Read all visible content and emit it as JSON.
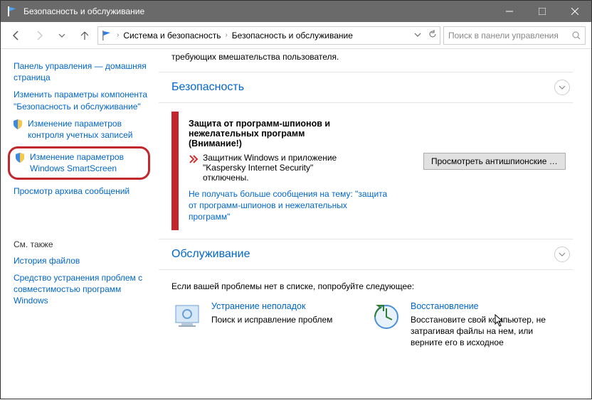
{
  "window": {
    "title": "Безопасность и обслуживание"
  },
  "breadcrumb": {
    "level1": "Система и безопасность",
    "level2": "Безопасность и обслуживание"
  },
  "search": {
    "placeholder": "Поиск в панели управления"
  },
  "sidebar": {
    "home": "Панель управления — домашняя страница",
    "change_component": "Изменить параметры компонента \"Безопасность и обслуживание\"",
    "uac": "Изменение параметров контроля учетных записей",
    "smartscreen": "Изменение параметров Windows SmartScreen",
    "archive": "Просмотр архива сообщений",
    "see_also_label": "См. также",
    "file_history": "История файлов",
    "compat_tool": "Средство устранения проблем с совместимостью программ Windows"
  },
  "main": {
    "intro": "требующих вмешательства пользователя.",
    "security_header": "Безопасность",
    "maintenance_header": "Обслуживание",
    "alert": {
      "heading_l1": "Защита от программ-шпионов и",
      "heading_l2": "нежелательных программ",
      "heading_l3": "(Внимание!)",
      "msg": "Защитник Windows и приложение \"Kaspersky Internet Security\" отключены.",
      "button": "Просмотреть антишпионские прил…",
      "link": "Не получать больше сообщения на тему: \"защита от программ-шпионов и нежелательных программ\""
    },
    "try_line": "Если вашей проблемы нет в списке, попробуйте следующее:",
    "troubleshoot": {
      "title": "Устранение неполадок",
      "desc": "Поиск и исправление проблем"
    },
    "recovery": {
      "title": "Восстановление",
      "desc": "Восстановите свой компьютер, не затрагивая файлы на нем, или верните его в исходное"
    }
  }
}
